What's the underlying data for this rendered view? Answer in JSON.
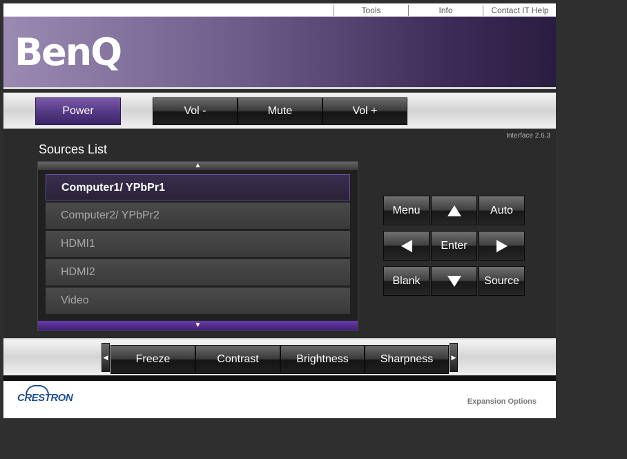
{
  "top_links": [
    "Tools",
    "Info",
    "Contact IT Help"
  ],
  "brand": {
    "logo_text": "BenQ"
  },
  "controls": {
    "power": "Power",
    "vol_down": "Vol -",
    "mute": "Mute",
    "vol_up": "Vol +"
  },
  "interface_version": "Interface 2.6.3",
  "sources": {
    "title": "Sources List",
    "scroll_up_icon": "▲",
    "scroll_down_icon": "▼",
    "items": [
      "Computer1/ YPbPr1",
      "Computer2/ YPbPr2",
      "HDMI1",
      "HDMI2",
      "Video"
    ],
    "selected_index": 0
  },
  "nav": {
    "menu": "Menu",
    "auto": "Auto",
    "enter": "Enter",
    "blank": "Blank",
    "source": "Source"
  },
  "adjust": {
    "left_icon": "◀",
    "right_icon": "▶",
    "items": [
      "Freeze",
      "Contrast",
      "Brightness",
      "Sharpness"
    ]
  },
  "footer": {
    "brand": "CRESTRON",
    "expansion": "Expansion Options"
  },
  "colors": {
    "accent_purple": "#553a86",
    "header_dark": "#2a1c40",
    "crestron_blue": "#1d4f96"
  }
}
